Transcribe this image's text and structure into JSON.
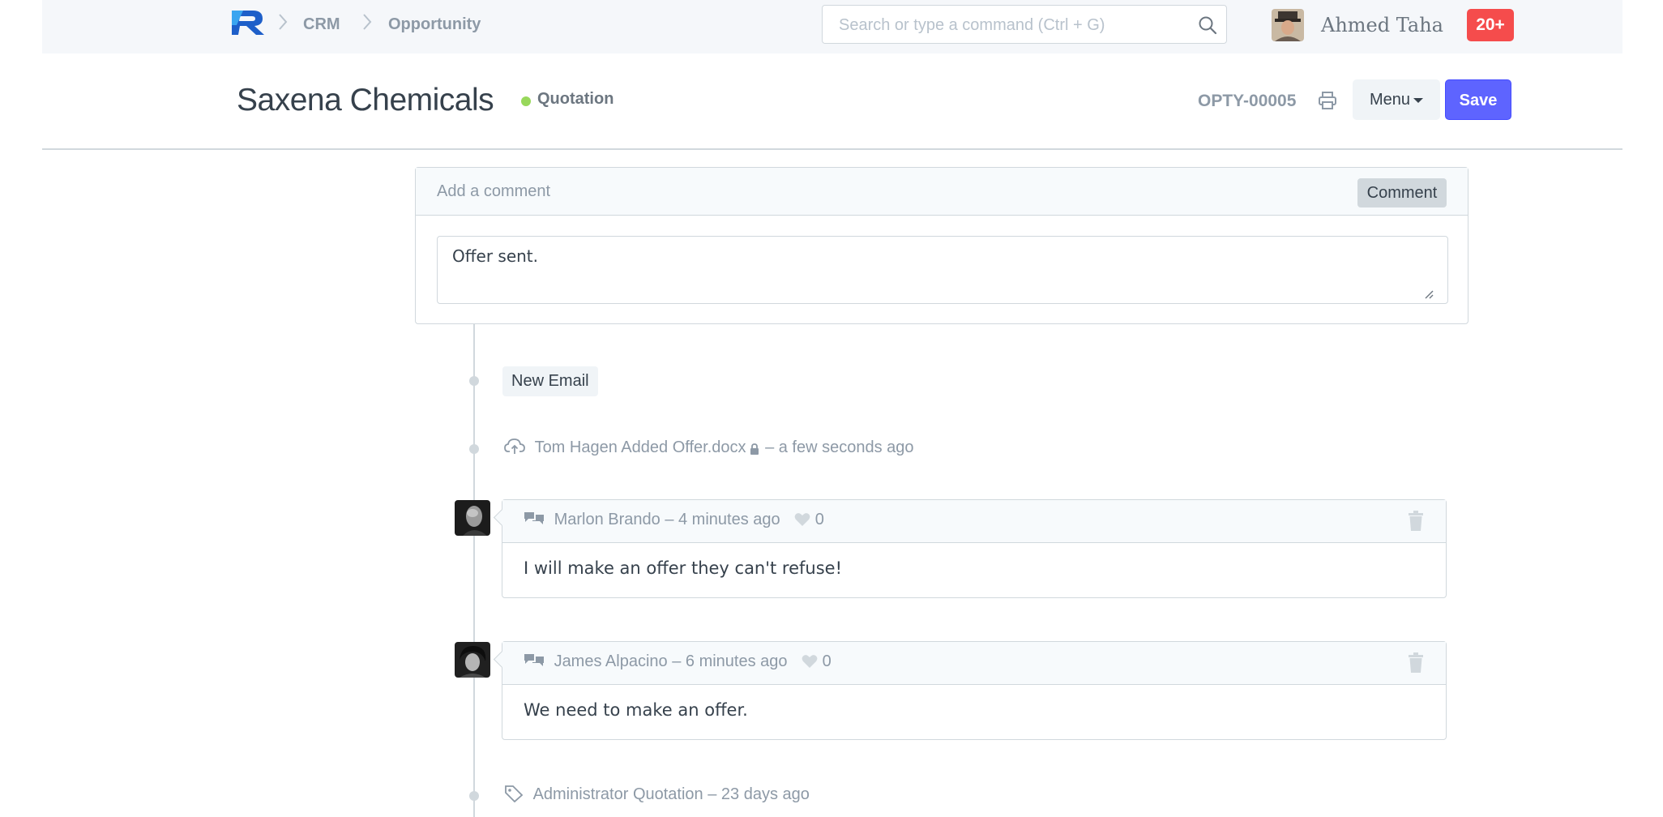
{
  "navbar": {
    "breadcrumbs": [
      "CRM",
      "Opportunity"
    ],
    "search": {
      "placeholder": "Search or type a command (Ctrl + G)",
      "value": ""
    },
    "user": {
      "name": "Ahmed Taha"
    },
    "notifications": "20+"
  },
  "page": {
    "title": "Saxena Chemicals",
    "status": "Quotation",
    "status_color": "#98d85b",
    "doc_id": "OPTY-00005",
    "menu_label": "Menu",
    "save_label": "Save",
    "accent": "#5e64ff"
  },
  "comment_box": {
    "header": "Add a comment",
    "button": "Comment",
    "value": "Offer sent."
  },
  "timeline": {
    "new_email": "New Email",
    "attachment": {
      "user": "Tom Hagen",
      "action": "Added",
      "file": "Offer.docx",
      "time": "– a few seconds ago"
    },
    "comments": [
      {
        "author": "Marlon Brando",
        "time": "– 4 minutes ago",
        "likes": "0",
        "text": "I will make an offer they can't refuse!"
      },
      {
        "author": "James Alpacino",
        "time": "– 6 minutes ago",
        "likes": "0",
        "text": "We need to make an offer."
      }
    ],
    "tag_event": {
      "user": "Administrator",
      "label": "Quotation",
      "time": "– 23 days ago"
    }
  }
}
